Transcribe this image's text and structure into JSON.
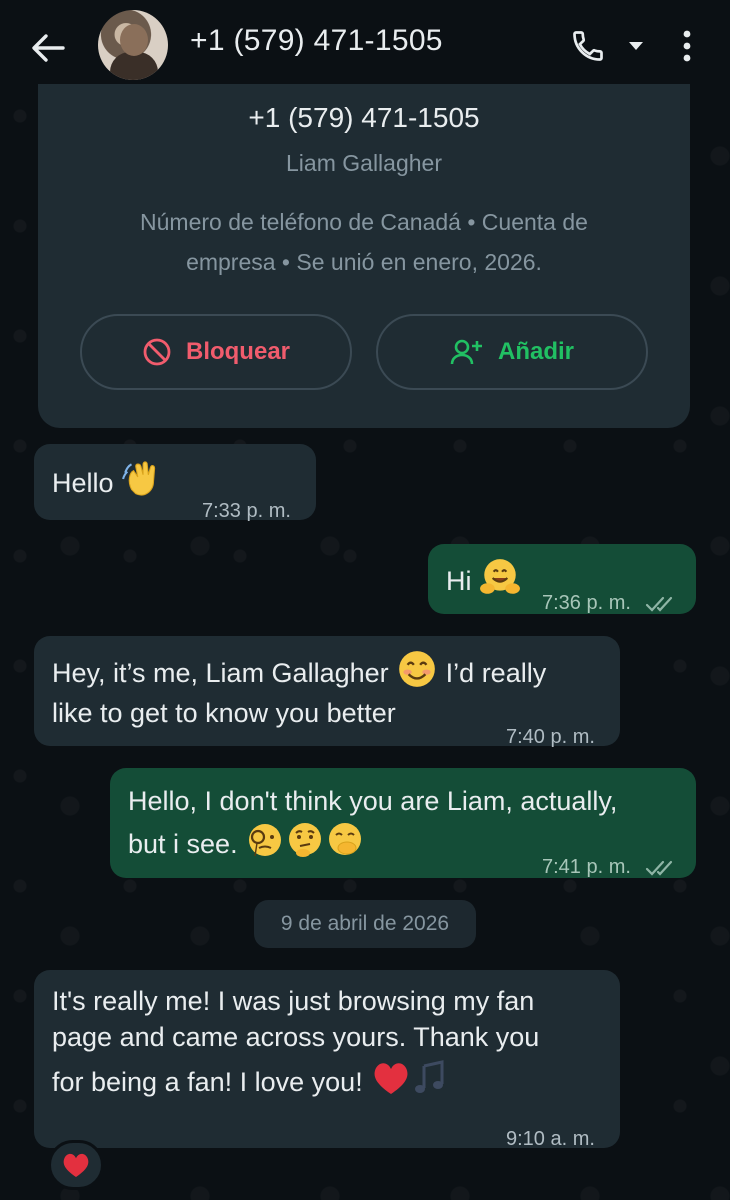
{
  "header": {
    "title": "+1 (579) 471-1505"
  },
  "info_card": {
    "phone": "+1 (579) 471-1505",
    "name": "Liam Gallagher",
    "description": "Número de teléfono de Canadá • Cuenta de empresa • Se unió en enero, 2026.",
    "block_label": "Bloquear",
    "add_label": "Añadir"
  },
  "messages": [
    {
      "direction": "in",
      "text": "Hello",
      "emoji": "waving-hand",
      "time": "7:33 p. m."
    },
    {
      "direction": "out",
      "text": "Hi",
      "emoji": "hugging-face",
      "time": "7:36 p. m.",
      "status": "read"
    },
    {
      "direction": "in",
      "line1": "Hey, it’s me, Liam Gallagher",
      "line1_after": "I’d really",
      "line2": "like to get to know you better",
      "time": "7:40 p. m."
    },
    {
      "direction": "out",
      "line1": "Hello, I don't think you are Liam, actually,",
      "line2": "but i see.",
      "time": "7:41 p. m.",
      "status": "read"
    },
    {
      "direction": "in",
      "line1": "It's really me! I was just browsing my fan",
      "line2": "page and came across yours. Thank you",
      "line3": "for being a fan! I love you!",
      "time": "9:10 a. m.",
      "reaction": "red-heart"
    }
  ],
  "date_divider": "9 de abril de 2026",
  "colors": {
    "background": "#0b1014",
    "incoming_bubble": "#1f2c33",
    "outgoing_bubble": "#144d37",
    "block_red": "#f15c6d",
    "add_green": "#21c063",
    "read_ticks": "#8696a0"
  }
}
